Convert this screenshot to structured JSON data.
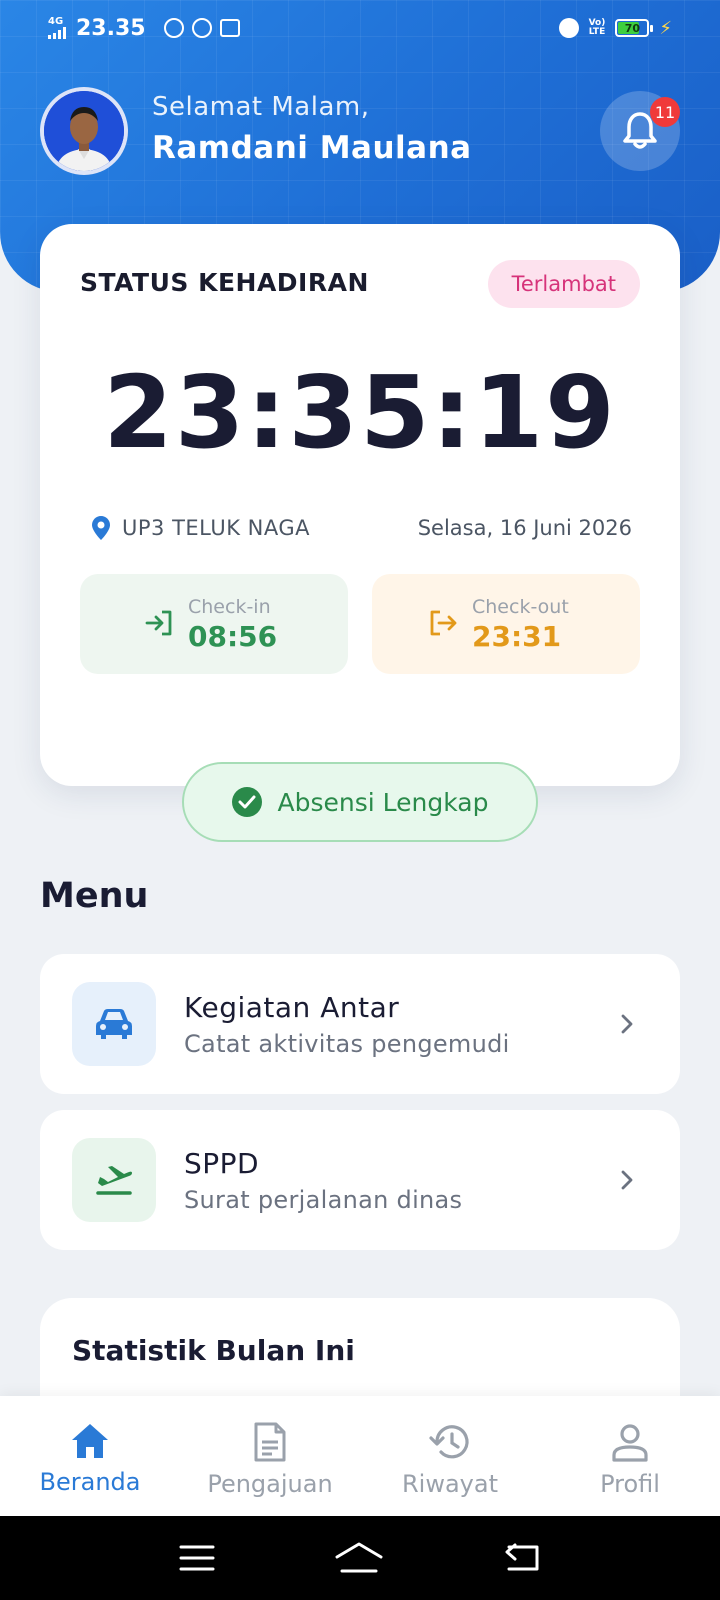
{
  "status_bar": {
    "network": "4G",
    "time": "23.35",
    "volte_top": "Vo)",
    "volte_bottom": "LTE",
    "battery": "70"
  },
  "header": {
    "greeting": "Selamat Malam,",
    "user_name": "Ramdani Maulana",
    "notification_count": "11"
  },
  "attendance": {
    "title": "STATUS KEHADIRAN",
    "status_badge": "Terlambat",
    "clock": "23:35:19",
    "location": "UP3 TELUK NAGA",
    "date": "Selasa, 16 Juni 2026",
    "checkin_label": "Check-in",
    "checkin_time": "08:56",
    "checkout_label": "Check-out",
    "checkout_time": "23:31",
    "complete_label": "Absensi Lengkap"
  },
  "menu": {
    "title": "Menu",
    "items": [
      {
        "title": "Kegiatan Antar",
        "subtitle": "Catat aktivitas pengemudi",
        "icon": "car-icon",
        "color": "#2a7ad6"
      },
      {
        "title": "SPPD",
        "subtitle": "Surat perjalanan dinas",
        "icon": "plane-takeoff-icon",
        "color": "#2a8a4a"
      }
    ]
  },
  "stats": {
    "title": "Statistik Bulan Ini"
  },
  "bottom_nav": {
    "items": [
      {
        "label": "Beranda",
        "icon": "home-icon",
        "active": true
      },
      {
        "label": "Pengajuan",
        "icon": "document-icon",
        "active": false
      },
      {
        "label": "Riwayat",
        "icon": "history-icon",
        "active": false
      },
      {
        "label": "Profil",
        "icon": "user-icon",
        "active": false
      }
    ]
  },
  "colors": {
    "primary": "#2a7ad6",
    "late": "#d6337a",
    "checkin": "#2e9254",
    "checkout": "#e2991a",
    "complete": "#2a8a4a"
  }
}
